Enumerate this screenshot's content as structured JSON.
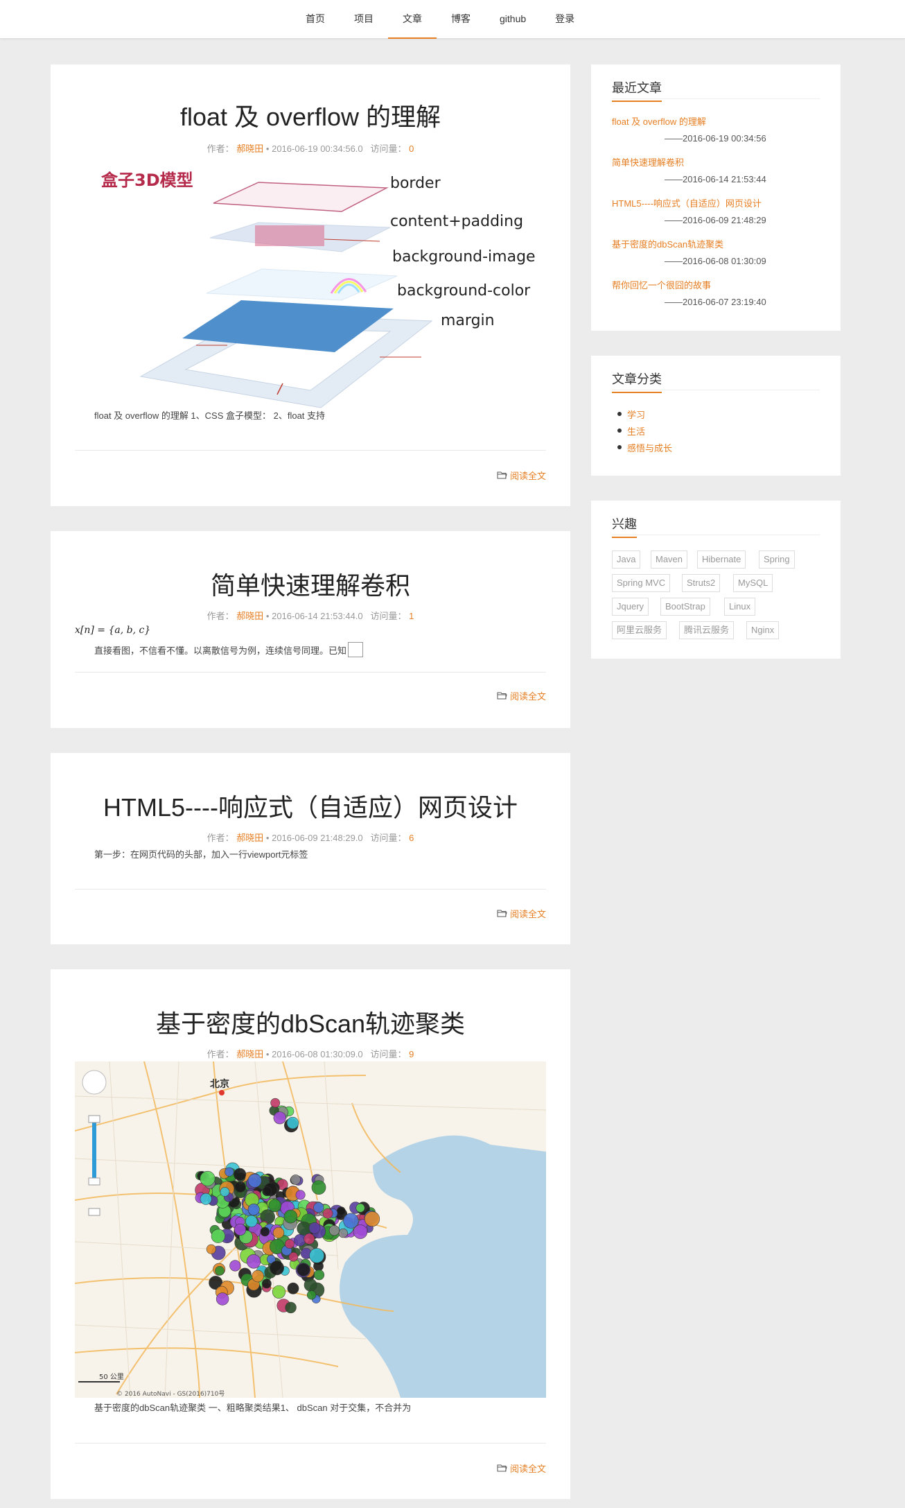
{
  "nav": {
    "items": [
      "首页",
      "项目",
      "文章",
      "博客",
      "github",
      "登录"
    ],
    "active_index": 2
  },
  "posts": [
    {
      "title": "float 及 overflow 的理解",
      "meta_author_label": "作者：",
      "author": "郝晓田",
      "date": "• 2016-06-19 00:34:56.0",
      "views_label": "访问量：",
      "views": "0",
      "image_title": "盒子3D模型",
      "image_labels": [
        "border",
        "content+padding",
        "background-image",
        "background-color",
        "margin"
      ],
      "summary": "float 及 overflow 的理解 1、CSS 盒子模型： 2、float 支持",
      "read_more": "阅读全文"
    },
    {
      "title": "简单快速理解卷积",
      "meta_author_label": "作者：",
      "author": "郝晓田",
      "date": "• 2016-06-14 21:53:44.0",
      "views_label": "访问量：",
      "views": "1",
      "formula": "x[n] = {a, b, c}",
      "summary": "直接看图，不信看不懂。以离散信号为例，连续信号同理。已知",
      "read_more": "阅读全文"
    },
    {
      "title": "HTML5----响应式（自适应）网页设计",
      "meta_author_label": "作者：",
      "author": "郝晓田",
      "date": "• 2016-06-09 21:48:29.0",
      "views_label": "访问量：",
      "views": "6",
      "summary": "第一步：在网页代码的头部，加入一行viewport元标签",
      "read_more": "阅读全文"
    },
    {
      "title": "基于密度的dbScan轨迹聚类",
      "meta_author_label": "作者：",
      "author": "郝晓田",
      "date": "• 2016-06-08 01:30:09.0",
      "views_label": "访问量：",
      "views": "9",
      "map_labels": {
        "city": "北京",
        "scale": "50 公里",
        "copyright": "© 2016 AutoNavi - GS(2016)710号"
      },
      "summary": "基于密度的dbScan轨迹聚类 一、粗略聚类结果1、 dbScan 对于交集，不合并为",
      "read_more": "阅读全文"
    }
  ],
  "sidebar": {
    "recent": {
      "title": "最近文章",
      "items": [
        {
          "title": "float 及 overflow 的理解",
          "date": "——2016-06-19 00:34:56"
        },
        {
          "title": "简单快速理解卷积",
          "date": "——2016-06-14 21:53:44"
        },
        {
          "title": "HTML5----响应式（自适应）网页设计",
          "date": "——2016-06-09 21:48:29"
        },
        {
          "title": "基于密度的dbScan轨迹聚类",
          "date": "——2016-06-08 01:30:09"
        },
        {
          "title": "帮你回忆一个很囧的故事",
          "date": "——2016-06-07 23:19:40"
        }
      ]
    },
    "categories": {
      "title": "文章分类",
      "items": [
        "学习",
        "生活",
        "感悟与成长"
      ]
    },
    "interests": {
      "title": "兴趣",
      "tags": [
        "Java",
        "Maven",
        "Hibernate",
        "Spring",
        "Spring MVC",
        "Struts2",
        "MySQL",
        "Jquery",
        "BootStrap",
        "Linux",
        "阿里云服务",
        "腾讯云服务",
        "Nginx"
      ]
    }
  },
  "colors": {
    "accent": "#e67e22",
    "background": "#ececec"
  }
}
